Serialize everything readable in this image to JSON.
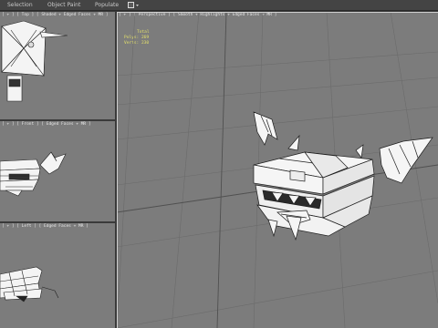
{
  "menu": {
    "items": [
      "Selection",
      "Object Paint",
      "Populate"
    ]
  },
  "viewports": {
    "top": {
      "label": "[ + ] [ Top ] [ Shaded + Edged Faces + MR ]"
    },
    "front": {
      "label": "[ + ] [ Front ] [ Edged Faces + MR ]"
    },
    "left": {
      "label": "[ + ] [ Left ] [ Edged Faces + MR ]"
    },
    "perspective": {
      "label": "[ + ] [ Perspective ] [ Smooth + Highlights + Edged Faces + MR ]"
    }
  },
  "stats": {
    "header": "Total",
    "polys": "Polys: 269",
    "verts": "Verts: 230"
  },
  "colors": {
    "viewport_bg": "#7c7c7c",
    "frame": "#3a3a3a",
    "stats_text": "#e3e06a",
    "active_border": "#cfcfcf"
  }
}
